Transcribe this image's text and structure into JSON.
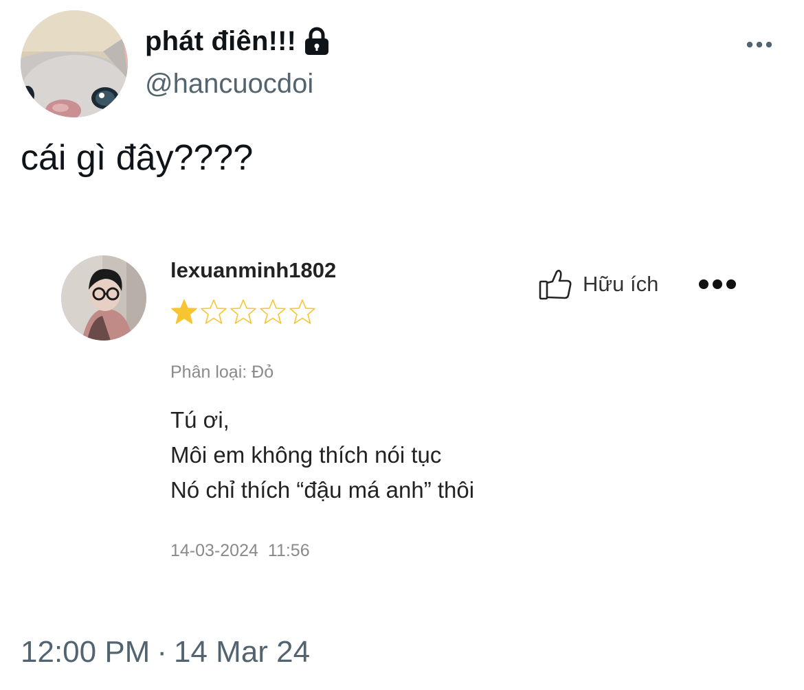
{
  "tweet": {
    "display_name": "phát điên!!!",
    "handle": "@hancuocdoi",
    "text": "cái gì đây????",
    "time": "12:00 PM",
    "separator": "·",
    "date": "14 Mar 24",
    "lock_icon": "lock-icon",
    "more_icon": "more-horizontal-icon"
  },
  "review": {
    "username": "lexuanminh1802",
    "rating": 1,
    "max_rating": 5,
    "helpful_label": "Hữu ích",
    "variant_label": "Phân loại: ",
    "variant_value": "Đỏ",
    "body_lines": [
      "Tú ơi,",
      "Môi em không thích nói tục",
      "Nó chỉ thích “đậu má anh” thôi"
    ],
    "date": "14-03-2024",
    "time": "11:56",
    "star_color": "#f7c531",
    "thumb_icon": "thumbs-up-icon",
    "more_icon": "more-horizontal-icon"
  }
}
